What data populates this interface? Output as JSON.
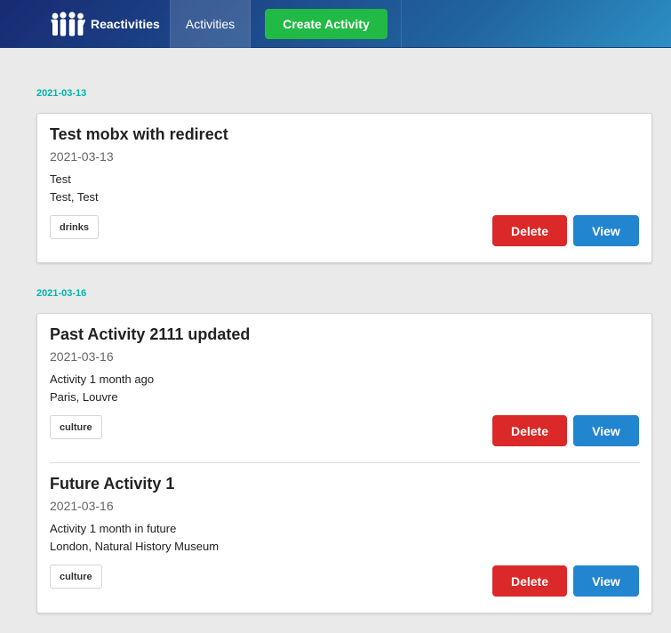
{
  "navbar": {
    "brand_label": "Reactivities",
    "brand_icon": "users-group-icon",
    "activities_label": "Activities",
    "create_label": "Create Activity",
    "colors": {
      "gradient_start": "#182a73",
      "gradient_end": "#2d8fc5",
      "create": "#21ba45"
    }
  },
  "groups": [
    {
      "date": "2021-03-13",
      "items": [
        {
          "title": "Test mobx with redirect",
          "date": "2021-03-13",
          "description": "Test",
          "venue": "Test, Test",
          "tag": "drinks",
          "delete_label": "Delete",
          "view_label": "View"
        }
      ]
    },
    {
      "date": "2021-03-16",
      "items": [
        {
          "title": "Past Activity 2111 updated",
          "date": "2021-03-16",
          "description": "Activity 1 month ago",
          "venue": "Paris, Louvre",
          "tag": "culture",
          "delete_label": "Delete",
          "view_label": "View"
        },
        {
          "title": "Future Activity 1",
          "date": "2021-03-16",
          "description": "Activity 1 month in future",
          "venue": "London, Natural History Museum",
          "tag": "culture",
          "delete_label": "Delete",
          "view_label": "View"
        }
      ]
    }
  ],
  "colors": {
    "group_header": "#00b5ad",
    "delete": "#db2828",
    "view": "#2185d0",
    "background": "#eaeaea"
  }
}
